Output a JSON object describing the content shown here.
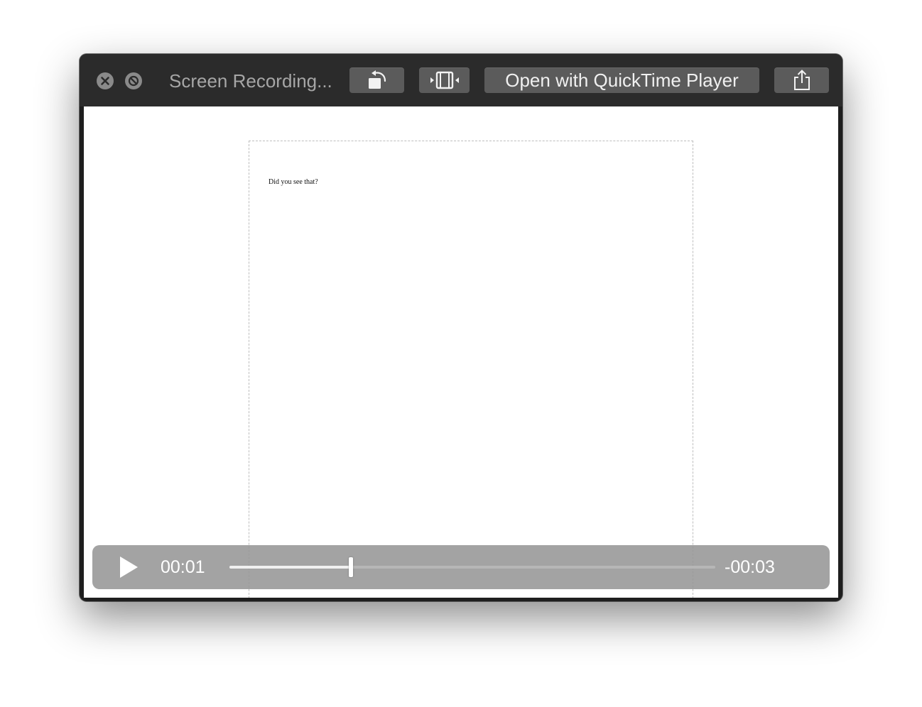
{
  "window": {
    "title": "Screen Recording...",
    "icons": {
      "close": "close-icon",
      "minimize": "minimize-icon",
      "rotate": "rotate-icon",
      "trim": "trim-icon",
      "share": "share-icon"
    }
  },
  "toolbar": {
    "open_label": "Open with QuickTime Player"
  },
  "document": {
    "text": "Did you see that?"
  },
  "player": {
    "elapsed": "00:01",
    "remaining": "-00:03",
    "progress": 0.25,
    "play_icon": "play-icon"
  },
  "colors": {
    "titlebar": "#2b2b2b",
    "button": "#5b5b5b",
    "controls": "#969696"
  }
}
